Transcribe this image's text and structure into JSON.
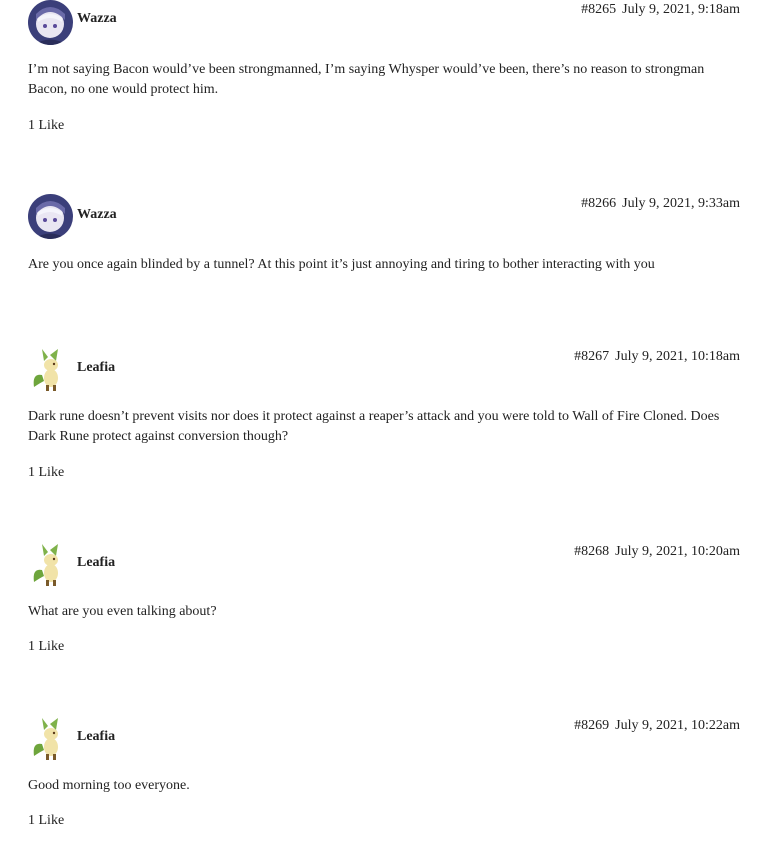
{
  "posts": [
    {
      "user": "Wazza",
      "avatar_icon": "anime-avatar-icon",
      "post_number": "#8265",
      "timestamp": "July 9, 2021, 9:18am",
      "body": "I’m not saying Bacon would’ve been strongmanned, I’m saying Whysper would’ve been, there’s no reason to strongman Bacon, no one would protect him.",
      "likes": "1 Like"
    },
    {
      "user": "Wazza",
      "avatar_icon": "anime-avatar-icon",
      "post_number": "#8266",
      "timestamp": "July 9, 2021, 9:33am",
      "body": "Are you once again blinded by a tunnel? At this point it’s just annoying and tiring to bother interacting with you",
      "likes": ""
    },
    {
      "user": "Leafia",
      "avatar_icon": "leafeon-avatar-icon",
      "post_number": "#8267",
      "timestamp": "July 9, 2021, 10:18am",
      "body": "Dark rune doesn’t prevent visits nor does it protect against a reaper’s attack and you were told to Wall of Fire Cloned. Does Dark Rune protect against conversion though?",
      "likes": "1 Like"
    },
    {
      "user": "Leafia",
      "avatar_icon": "leafeon-avatar-icon",
      "post_number": "#8268",
      "timestamp": "July 9, 2021, 10:20am",
      "body": "What are you even talking about?",
      "likes": "1 Like"
    },
    {
      "user": "Leafia",
      "avatar_icon": "leafeon-avatar-icon",
      "post_number": "#8269",
      "timestamp": "July 9, 2021, 10:22am",
      "body": "Good morning too everyone.",
      "likes": "1 Like"
    }
  ]
}
